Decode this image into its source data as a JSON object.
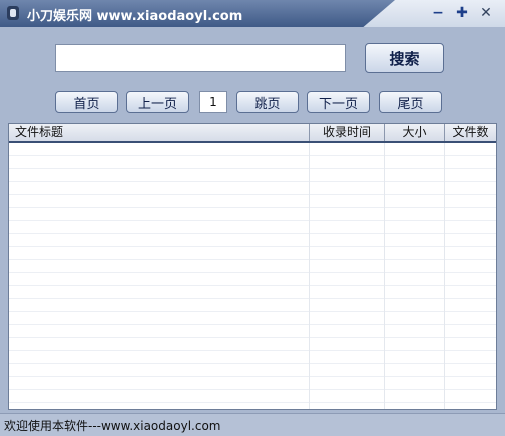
{
  "window": {
    "title": "小刀娱乐网 www.xiaodaoyl.com",
    "controls": [
      "minimize",
      "maximize",
      "close"
    ]
  },
  "search": {
    "value": "",
    "button_label": "搜索"
  },
  "pager": {
    "first": "首页",
    "prev": "上一页",
    "page_value": "1",
    "jump": "跳页",
    "next": "下一页",
    "last": "尾页"
  },
  "table": {
    "columns": [
      "文件标题",
      "收录时间",
      "大小",
      "文件数"
    ],
    "rows": []
  },
  "status": {
    "text": "欢迎使用本软件---www.xiaodaoyl.com"
  },
  "colors": {
    "window_bg": "#a9b7cf",
    "title_accent": "#3f5a87",
    "control_blue": "#1d3f8a"
  }
}
